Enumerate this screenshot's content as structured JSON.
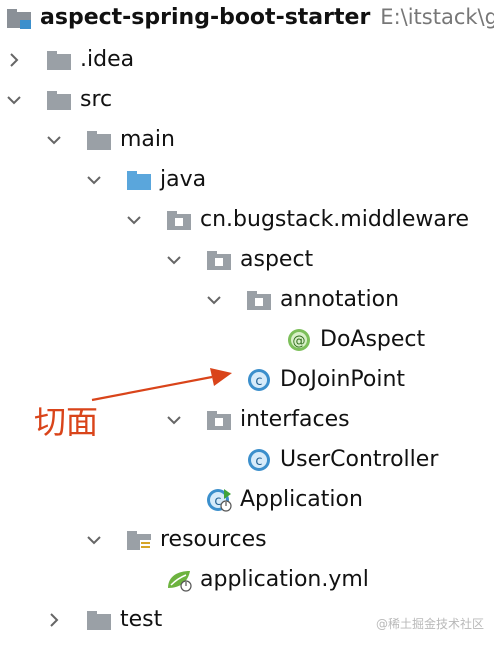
{
  "project": {
    "name": "aspect-spring-boot-starter",
    "path": "E:\\itstack\\g"
  },
  "tree": {
    "idea": ".idea",
    "src": "src",
    "main": "main",
    "java": "java",
    "package": "cn.bugstack.middleware",
    "aspect": "aspect",
    "annotation": "annotation",
    "do_aspect": "DoAspect",
    "do_join_point": "DoJoinPoint",
    "interfaces": "interfaces",
    "user_controller": "UserController",
    "application": "Application",
    "resources": "resources",
    "application_yml": "application.yml",
    "test": "test"
  },
  "annotation_label": "切面",
  "watermark": "@稀土掘金技术社区",
  "colors": {
    "annotation": "#d9441a",
    "folder": "#9aa0a6",
    "class_icon": "#3b8fcc",
    "annotation_icon": "#5a9e3a"
  }
}
